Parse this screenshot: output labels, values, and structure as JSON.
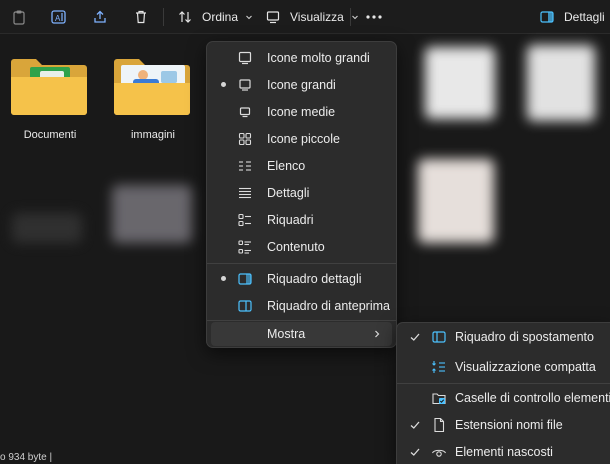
{
  "toolbar": {
    "sort_label": "Ordina",
    "view_label": "Visualizza",
    "details_label": "Dettagli"
  },
  "folders": [
    {
      "name": "Documenti"
    },
    {
      "name": "immagini"
    }
  ],
  "status": {
    "text": "o  934 byte  |"
  },
  "view_menu": {
    "items": [
      {
        "label": "Icone molto grandi",
        "icon": "monitor-icon",
        "selected": false
      },
      {
        "label": "Icone grandi",
        "icon": "monitor-icon",
        "selected": true
      },
      {
        "label": "Icone medie",
        "icon": "monitor-icon",
        "selected": false
      },
      {
        "label": "Icone piccole",
        "icon": "grid-icon",
        "selected": false
      },
      {
        "label": "Elenco",
        "icon": "list-icon",
        "selected": false
      },
      {
        "label": "Dettagli",
        "icon": "details-icon",
        "selected": false
      },
      {
        "label": "Riquadri",
        "icon": "tiles-icon",
        "selected": false
      },
      {
        "label": "Contenuto",
        "icon": "content-icon",
        "selected": false
      },
      {
        "label": "Riquadro dettagli",
        "icon": "details-pane-icon",
        "selected": true
      },
      {
        "label": "Riquadro di anteprima",
        "icon": "preview-pane-icon",
        "selected": false
      },
      {
        "label": "Mostra",
        "icon": "",
        "selected": false
      }
    ]
  },
  "show_submenu": {
    "items": [
      {
        "label": "Riquadro di spostamento",
        "checked": true,
        "icon": "navigation-pane-icon"
      },
      {
        "label": "Visualizzazione compatta",
        "checked": false,
        "icon": "compact-view-icon"
      },
      {
        "label": "Caselle di controllo elementi",
        "checked": false,
        "icon": "checkbox-icon"
      },
      {
        "label": "Estensioni nomi file",
        "checked": true,
        "icon": "file-icon"
      },
      {
        "label": "Elementi nascosti",
        "checked": true,
        "icon": "eye-icon"
      }
    ]
  },
  "colors": {
    "accent": "#4cc2ff",
    "folder": "#f5c24a",
    "menu_bg": "#2c2c2c"
  }
}
